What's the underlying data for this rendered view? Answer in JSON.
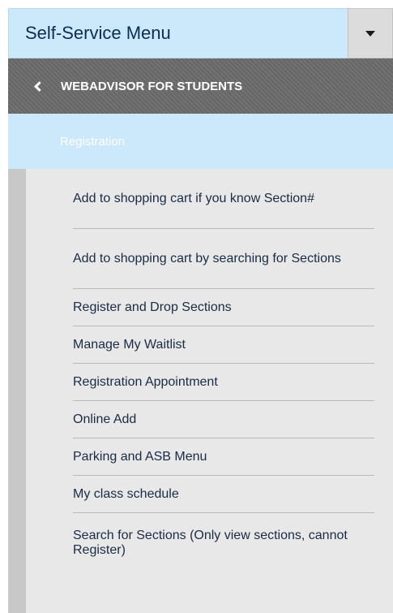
{
  "header": {
    "title": "Self-Service Menu"
  },
  "back_nav": {
    "label": "WEBADVISOR FOR STUDENTS"
  },
  "section": {
    "label": "Registration"
  },
  "items": [
    "Add to shopping cart if you know Section#",
    "Add to shopping cart by searching for Sections",
    "Register and Drop Sections",
    "Manage My Waitlist",
    "Registration Appointment",
    "Online Add",
    "Parking and ASB Menu",
    "My class schedule",
    "Search for Sections (Only view sections, cannot Register)"
  ]
}
